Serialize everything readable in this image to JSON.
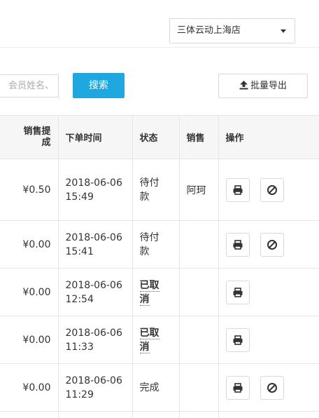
{
  "store_select": {
    "value": "三体云动上海店"
  },
  "search": {
    "placeholder": "、会员姓名",
    "button_label": "搜索"
  },
  "export": {
    "label": "批量导出"
  },
  "table": {
    "columns": [
      "销售提成",
      "下单时间",
      "状态",
      "销售",
      "操作"
    ],
    "rows": [
      {
        "commission": "¥0.50",
        "date": "2018-06-06",
        "time": "15:49",
        "status_1": "待付",
        "status_2": "款",
        "status_bold": false,
        "sales": "阿珂",
        "actions": [
          "print",
          "cancel"
        ]
      },
      {
        "commission": "¥0.00",
        "date": "2018-06-06",
        "time": "15:41",
        "status_1": "待付",
        "status_2": "款",
        "status_bold": false,
        "sales": "",
        "actions": [
          "print",
          "cancel"
        ]
      },
      {
        "commission": "¥0.00",
        "date": "2018-06-06",
        "time": "12:54",
        "status_1": "已取",
        "status_2": "消",
        "status_bold": true,
        "sales": "",
        "actions": [
          "print"
        ]
      },
      {
        "commission": "¥0.00",
        "date": "2018-06-06",
        "time": "11:33",
        "status_1": "已取",
        "status_2": "消",
        "status_bold": true,
        "sales": "",
        "actions": [
          "print"
        ]
      },
      {
        "commission": "¥0.00",
        "date": "2018-06-06",
        "time": "11:29",
        "status_1": "完成",
        "status_2": "",
        "status_bold": false,
        "sales": "",
        "actions": [
          "print",
          "cancel"
        ]
      }
    ]
  },
  "icons": {
    "print": "printer-icon",
    "cancel": "ban-icon",
    "export": "upload-icon"
  },
  "colors": {
    "primary_button": "#1fa8e0",
    "header_bg": "#f6f6f6",
    "border": "#e5e5e5"
  }
}
